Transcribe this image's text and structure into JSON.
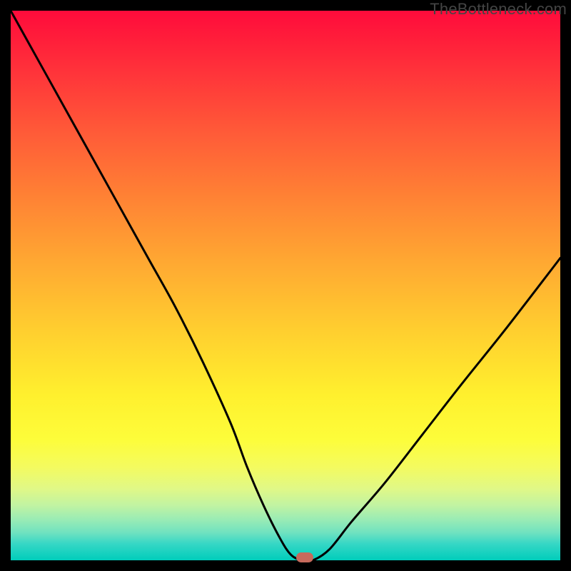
{
  "watermark": "TheBottleneck.com",
  "chart_data": {
    "type": "line",
    "title": "",
    "xlabel": "",
    "ylabel": "",
    "xlim": [
      0,
      100
    ],
    "ylim": [
      0,
      100
    ],
    "background_gradient": {
      "top": "#ff0b3b",
      "bottom": "#00cdbb",
      "meaning": "bottleneck severity (red=high, green=none)"
    },
    "series": [
      {
        "name": "bottleneck-curve",
        "x": [
          0,
          5,
          10,
          15,
          20,
          25,
          30,
          35,
          40,
          43,
          46,
          49,
          51,
          53,
          55,
          58,
          62,
          68,
          75,
          82,
          90,
          100
        ],
        "values": [
          100,
          91,
          82,
          73,
          64,
          55,
          46,
          36,
          25,
          17,
          10,
          4,
          1,
          0,
          0,
          2,
          7,
          14,
          23,
          32,
          42,
          55
        ]
      }
    ],
    "marker": {
      "name": "optimal-point",
      "x": 53.5,
      "y": 0.5,
      "color": "#c76a5c"
    },
    "annotations": []
  }
}
